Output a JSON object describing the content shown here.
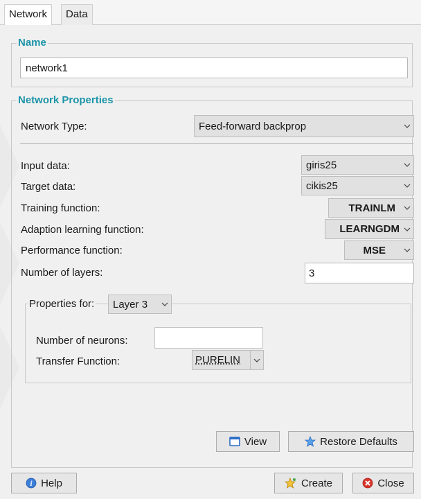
{
  "tabs": [
    {
      "label": "Network"
    },
    {
      "label": "Data"
    }
  ],
  "name_group": {
    "title": "Name",
    "value": "network1"
  },
  "properties_group": {
    "title": "Network Properties",
    "network_type": {
      "label": "Network Type:",
      "value": "Feed-forward backprop"
    },
    "input_data": {
      "label": "Input data:",
      "value": "giris25"
    },
    "target_data": {
      "label": "Target data:",
      "value": "cikis25"
    },
    "training_function": {
      "label": "Training function:",
      "value": "TRAINLM"
    },
    "adaption_function": {
      "label": "Adaption learning function:",
      "value": "LEARNGDM"
    },
    "performance_function": {
      "label": "Performance function:",
      "value": "MSE"
    },
    "num_layers": {
      "label": "Number of layers:",
      "value": "3"
    }
  },
  "layer_group": {
    "title": "Properties for:",
    "layer_value": "Layer 3",
    "num_neurons": {
      "label": "Number of neurons:",
      "value": ""
    },
    "transfer_function": {
      "label": "Transfer Function:",
      "value": "PURELIN"
    }
  },
  "buttons": {
    "view": "View",
    "restore": "Restore Defaults",
    "help": "Help",
    "create": "Create",
    "close": "Close"
  },
  "colors": {
    "title_accent": "#1c94a8",
    "background": "#f0f0f0"
  },
  "icons": [
    "chevron-down-icon",
    "view-window-icon",
    "star-icon",
    "help-icon",
    "create-star-icon",
    "close-icon"
  ]
}
